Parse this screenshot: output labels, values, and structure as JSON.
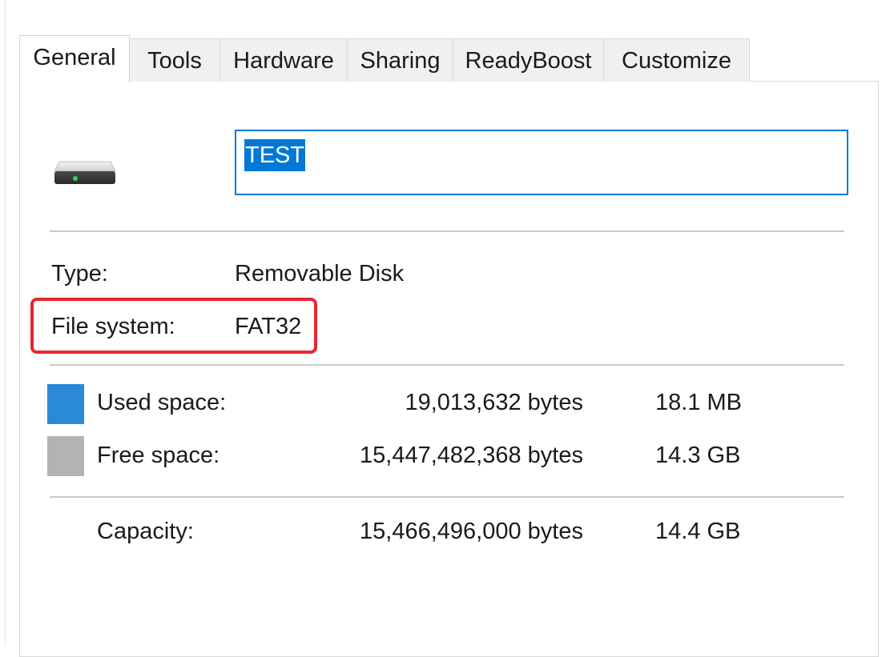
{
  "tabs": [
    {
      "label": "General",
      "active": true
    },
    {
      "label": "Tools",
      "active": false
    },
    {
      "label": "Hardware",
      "active": false
    },
    {
      "label": "Sharing",
      "active": false
    },
    {
      "label": "ReadyBoost",
      "active": false
    },
    {
      "label": "Customize",
      "active": false
    }
  ],
  "drive": {
    "icon": "removable-drive-icon",
    "name_value": "TEST"
  },
  "info": {
    "type_label": "Type:",
    "type_value": "Removable Disk",
    "fs_label": "File system:",
    "fs_value": "FAT32"
  },
  "space": {
    "used_label": "Used space:",
    "used_bytes": "19,013,632 bytes",
    "used_human": "18.1 MB",
    "used_color": "#2a8ad8",
    "free_label": "Free space:",
    "free_bytes": "15,447,482,368 bytes",
    "free_human": "14.3 GB",
    "free_color": "#b3b3b3",
    "capacity_label": "Capacity:",
    "capacity_bytes": "15,466,496,000 bytes",
    "capacity_human": "14.4 GB"
  },
  "colors": {
    "accent": "#0078d7",
    "annotation": "#e8262d"
  }
}
